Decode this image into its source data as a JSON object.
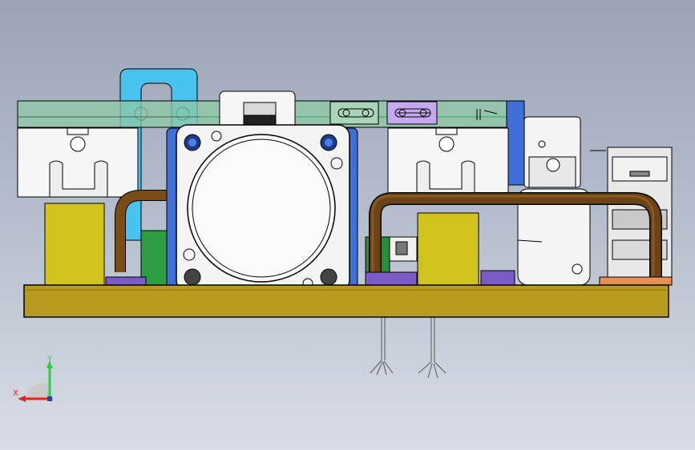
{
  "viewport": {
    "background_top": "#9aa4b6",
    "background_bottom": "#d9dde6"
  },
  "colors": {
    "base_plate": "#b89a1c",
    "yellow_block": "#d2c21c",
    "green_rail": "#8fcaa6",
    "cyan_bracket": "#47c3ee",
    "bronze_pipe": "#6b4316",
    "purple": "#7b5cc4",
    "blue": "#3f6fd6",
    "motor_body": "#f4f4f4",
    "outline": "#000000"
  },
  "triad": {
    "y_label": "Y",
    "x_label": "X",
    "y_color": "#2ecc40",
    "x_color": "#e0261f",
    "z_color": "#1f3fbf"
  }
}
